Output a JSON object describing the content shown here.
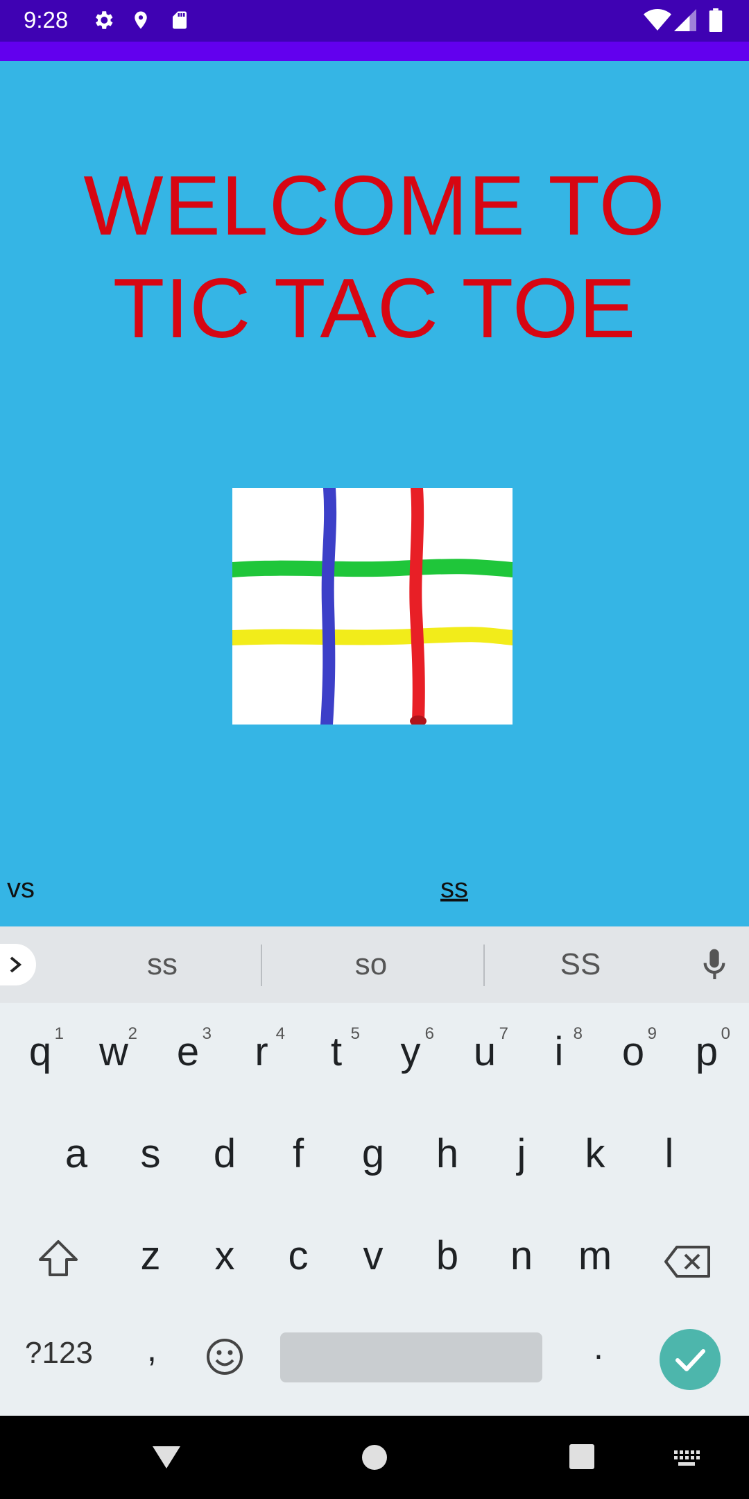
{
  "status_bar": {
    "time": "9:28",
    "icons_left": [
      "gear-icon",
      "location-icon",
      "sd-card-icon"
    ],
    "icons_right": [
      "wifi-icon",
      "signal-icon",
      "battery-icon"
    ]
  },
  "main": {
    "title_line1": "WELCOME TO",
    "title_line2": "TIC TAC TOE",
    "board_image": "tic-tac-toe-board",
    "player1_field": "vs",
    "player2_field": "ss"
  },
  "keyboard": {
    "suggestions": [
      "ss",
      "so",
      "SS"
    ],
    "row1": [
      {
        "key": "q",
        "hint": "1"
      },
      {
        "key": "w",
        "hint": "2"
      },
      {
        "key": "e",
        "hint": "3"
      },
      {
        "key": "r",
        "hint": "4"
      },
      {
        "key": "t",
        "hint": "5"
      },
      {
        "key": "y",
        "hint": "6"
      },
      {
        "key": "u",
        "hint": "7"
      },
      {
        "key": "i",
        "hint": "8"
      },
      {
        "key": "o",
        "hint": "9"
      },
      {
        "key": "p",
        "hint": "0"
      }
    ],
    "row2": [
      "a",
      "s",
      "d",
      "f",
      "g",
      "h",
      "j",
      "k",
      "l"
    ],
    "row3": [
      "z",
      "x",
      "c",
      "v",
      "b",
      "n",
      "m"
    ],
    "symbols_label": "?123",
    "comma": ",",
    "period": "."
  },
  "colors": {
    "background": "#35B5E5",
    "title": "#D70612",
    "status_bar": "#3F02B3",
    "app_bar": "#6200EE",
    "enter_key": "#4DB6AC"
  }
}
